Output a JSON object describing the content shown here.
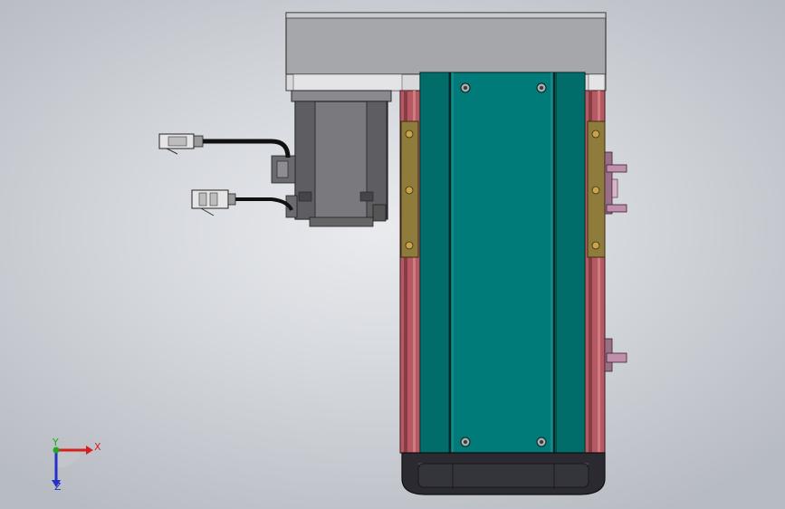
{
  "app": {
    "view_type": "cad-3d-viewport",
    "background_colors": [
      "#e9ebee",
      "#b7bbc2"
    ]
  },
  "model": {
    "description_visible": false,
    "colors": {
      "top_plate": "#a9a9ab",
      "carriage": "#007a78",
      "carriage_dark": "#005f5d",
      "rail": "#b0525a",
      "rail_dark": "#7a2f37",
      "guide_strip": "#8d7a3a",
      "motor_body": "#7f7f82",
      "motor_dark": "#4e4e52",
      "end_cap": "#2b2b30",
      "bracket": "#b58aa4",
      "connector": "#d8d8d8",
      "cable": "#1a1a1a"
    }
  },
  "triad": {
    "x_label": "X",
    "y_label": "Y",
    "z_label": "Z",
    "x_color": "#d62020",
    "y_color": "#1faa1f",
    "z_color": "#2530c8"
  }
}
